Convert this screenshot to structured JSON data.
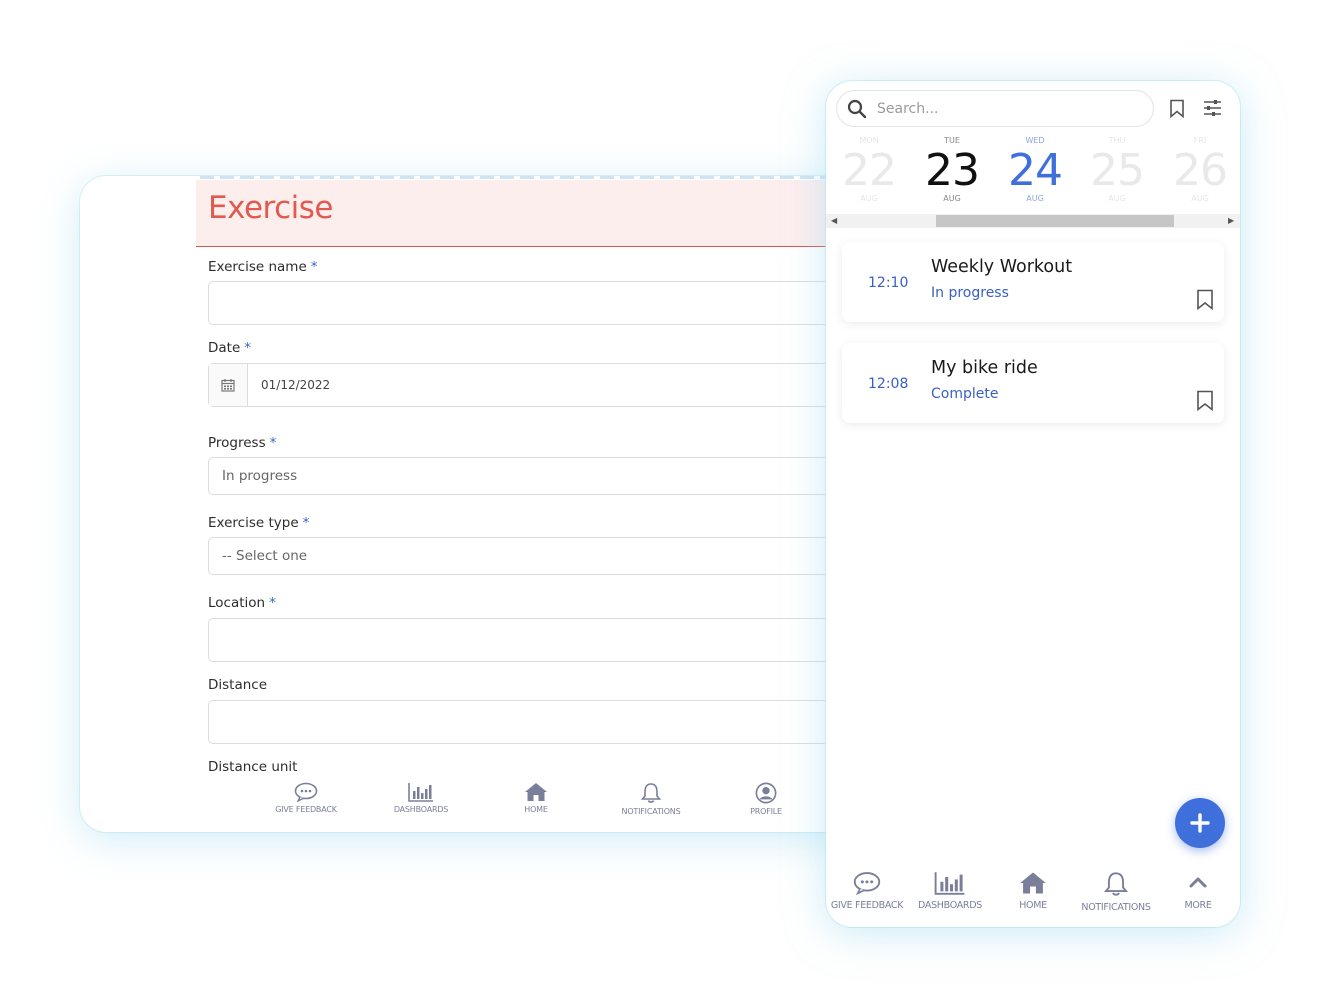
{
  "form": {
    "title": "Exercise",
    "fields": {
      "exercise_name": {
        "label": "Exercise name",
        "required_mark": "*",
        "value": ""
      },
      "date": {
        "label": "Date",
        "required_mark": "*",
        "value": "01/12/2022"
      },
      "progress": {
        "label": "Progress",
        "required_mark": "*",
        "value": "In progress"
      },
      "exercise_type": {
        "label": "Exercise type",
        "required_mark": "*",
        "value": "-- Select one"
      },
      "location": {
        "label": "Location",
        "required_mark": "*",
        "value": ""
      },
      "distance": {
        "label": "Distance",
        "value": ""
      },
      "distance_unit": {
        "label": "Distance unit"
      }
    },
    "nav": [
      {
        "label": "GIVE FEEDBACK",
        "icon": "chat-icon"
      },
      {
        "label": "DASHBOARDS",
        "icon": "bar-chart-icon"
      },
      {
        "label": "HOME",
        "icon": "home-icon"
      },
      {
        "label": "NOTIFICATIONS",
        "icon": "bell-icon"
      },
      {
        "label": "PROFILE",
        "icon": "user-circle-icon"
      }
    ]
  },
  "mobile": {
    "search": {
      "placeholder": "Search..."
    },
    "dates": [
      {
        "dow": "MON",
        "num": "22",
        "mon": "AUG"
      },
      {
        "dow": "TUE",
        "num": "23",
        "mon": "AUG"
      },
      {
        "dow": "WED",
        "num": "24",
        "mon": "AUG"
      },
      {
        "dow": "THU",
        "num": "25",
        "mon": "AUG"
      },
      {
        "dow": "FRI",
        "num": "26",
        "mon": "AUG"
      }
    ],
    "entries": [
      {
        "time": "12:10",
        "title": "Weekly Workout",
        "status": "In progress"
      },
      {
        "time": "12:08",
        "title": "My bike ride",
        "status": "Complete"
      }
    ],
    "nav": [
      {
        "label": "GIVE FEEDBACK",
        "icon": "chat-icon"
      },
      {
        "label": "DASHBOARDS",
        "icon": "bar-chart-icon"
      },
      {
        "label": "HOME",
        "icon": "home-icon"
      },
      {
        "label": "NOTIFICATIONS",
        "icon": "bell-icon"
      },
      {
        "label": "MORE",
        "icon": "chevron-up-icon"
      }
    ]
  },
  "colors": {
    "accent": "#3f6fdb",
    "header_red": "#e05a4f",
    "header_bg": "#fdeeee",
    "nav_icon": "#7b7e9a"
  }
}
